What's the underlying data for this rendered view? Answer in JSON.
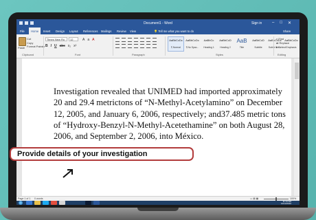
{
  "app": {
    "title": "Document1 - Word",
    "signin": "Sign in",
    "tabs": [
      "File",
      "Home",
      "Insert",
      "Design",
      "Layout",
      "References",
      "Mailings",
      "Review",
      "View"
    ],
    "tell_me": "Tell me what you want to do",
    "share": "Share"
  },
  "ribbon": {
    "paste": "Paste",
    "clipboard_items": [
      "Cut",
      "Copy",
      "Format Painter"
    ],
    "font_name": "Times New Ro",
    "font_size": "12",
    "format_buttons": [
      "B",
      "I",
      "U",
      "abc",
      "x₂",
      "x²"
    ],
    "group_labels": [
      "Clipboard",
      "Font",
      "Paragraph",
      "Styles",
      "Editing"
    ],
    "styles": [
      {
        "preview": "AaBbCcDc",
        "name": "¶ Normal"
      },
      {
        "preview": "AaBbCcDc",
        "name": "¶ No Spac..."
      },
      {
        "preview": "AaBbCc",
        "name": "Heading 1"
      },
      {
        "preview": "AaBbCcD",
        "name": "Heading 2"
      },
      {
        "preview": "AaB",
        "name": "Title"
      },
      {
        "preview": "AaBbCcD",
        "name": "Subtitle"
      },
      {
        "preview": "AaBbCcDc",
        "name": "Subtle Em..."
      },
      {
        "preview": "AaBbCcDc",
        "name": "Emphasis"
      }
    ],
    "editing": [
      "Find",
      "Replace",
      "Select"
    ]
  },
  "document": {
    "text": "Investigation revealed that UNIMED had imported approximately 20 and 29.4 metrictons of “N-Methyl-Acetylamino” on December 12, 2005, and January 6, 2006, respectively; and37.485 metric tons of “Hydroxy-Benzyl-N-Methyl-Acetethamine” on both August 28, 2006, and September 2, 2006, into México."
  },
  "callout": {
    "text": "Provide details of your investigation"
  },
  "status": {
    "page": "Page 1 of 1",
    "words": "0 words",
    "zoom": "100%"
  },
  "taskbar": {
    "time": "11:14 AM",
    "date": "10/14/2016"
  },
  "colors": {
    "word_blue": "#2b579a",
    "callout_border": "#b23b3b",
    "background": "#5dbab4"
  }
}
